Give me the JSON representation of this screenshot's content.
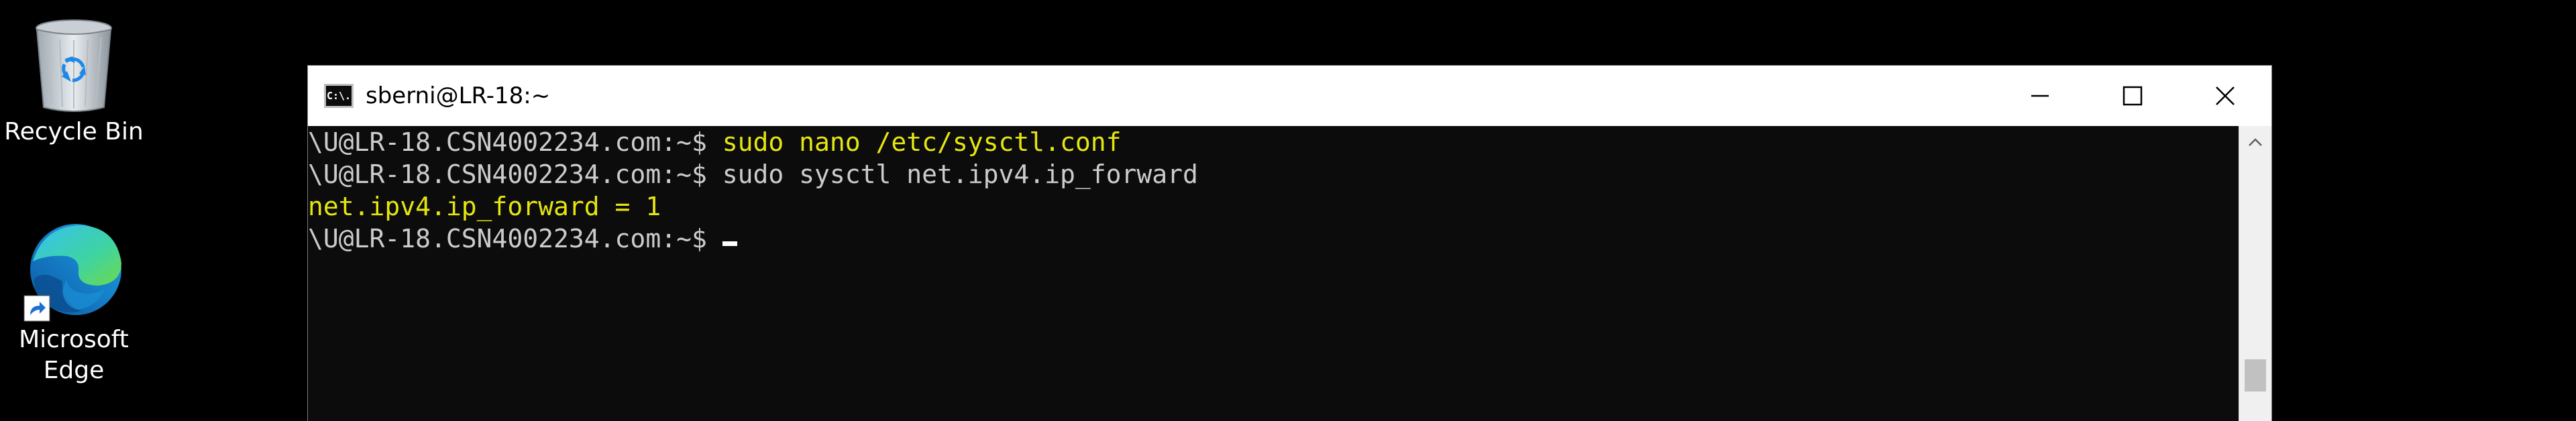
{
  "desktop": {
    "icons": [
      {
        "label": "Recycle Bin",
        "icon": "recycle-bin-icon"
      },
      {
        "label": "Microsoft\nEdge",
        "icon": "edge-icon"
      }
    ]
  },
  "window": {
    "title": "sberni@LR-18:~",
    "app_icon_text": "C:\\.",
    "controls": {
      "minimize": "minimize-icon",
      "maximize": "maximize-icon",
      "close": "close-icon"
    }
  },
  "console": {
    "lines": [
      {
        "prompt": "\\U@LR-18.CSN4002234.com:~$ ",
        "command": "sudo nano /etc/sysctl.conf"
      },
      {
        "prompt": "\\U@LR-18.CSN4002234.com:~$ ",
        "command": "sudo sysctl net.ipv4.ip_forward"
      },
      {
        "output": "net.ipv4.ip_forward = 1"
      },
      {
        "prompt": "\\U@LR-18.CSN4002234.com:~$ ",
        "command": ""
      }
    ]
  },
  "colors": {
    "terminal_bg": "#0c0c0c",
    "prompt_text": "#cccccc",
    "highlight_text": "#e5e510",
    "titlebar_bg": "#ffffff"
  }
}
